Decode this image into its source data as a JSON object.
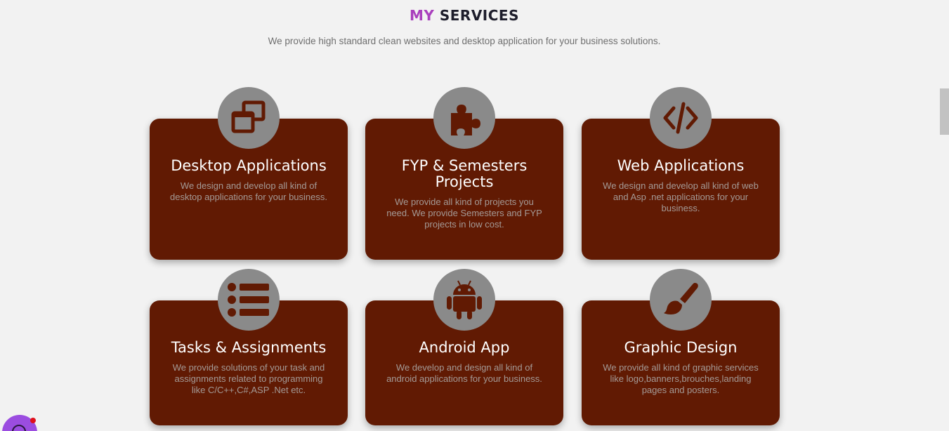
{
  "header": {
    "title_accent": "MY",
    "title_rest": "SERVICES",
    "subtitle": "We provide high standard clean websites and desktop application for your business solutions."
  },
  "colors": {
    "accent": "#a93fbd",
    "card_bg": "#611a03",
    "icon_circle": "#8a8a8a",
    "page_bg": "#f2f2f2"
  },
  "services": [
    {
      "icon": "windows-icon",
      "title": "Desktop Applications",
      "description": "We design and develop all kind of desktop applications for your business."
    },
    {
      "icon": "puzzle-icon",
      "title": "FYP & Semesters Projects",
      "description": "We provide all kind of projects you need. We provide Semesters and FYP projects in low cost."
    },
    {
      "icon": "code-icon",
      "title": "Web Applications",
      "description": "We design and develop all kind of web and Asp .net applications for your business."
    },
    {
      "icon": "list-icon",
      "title": "Tasks & Assignments",
      "description": "We provide solutions of your task and assignments related to programming like C/C++,C#,ASP .Net etc."
    },
    {
      "icon": "android-icon",
      "title": "Android App",
      "description": "We develop and design all kind of android applications for your business."
    },
    {
      "icon": "paint-brush-icon",
      "title": "Graphic Design",
      "description": "We provide all kind of graphic services like logo,banners,brouches,landing pages and posters."
    }
  ]
}
